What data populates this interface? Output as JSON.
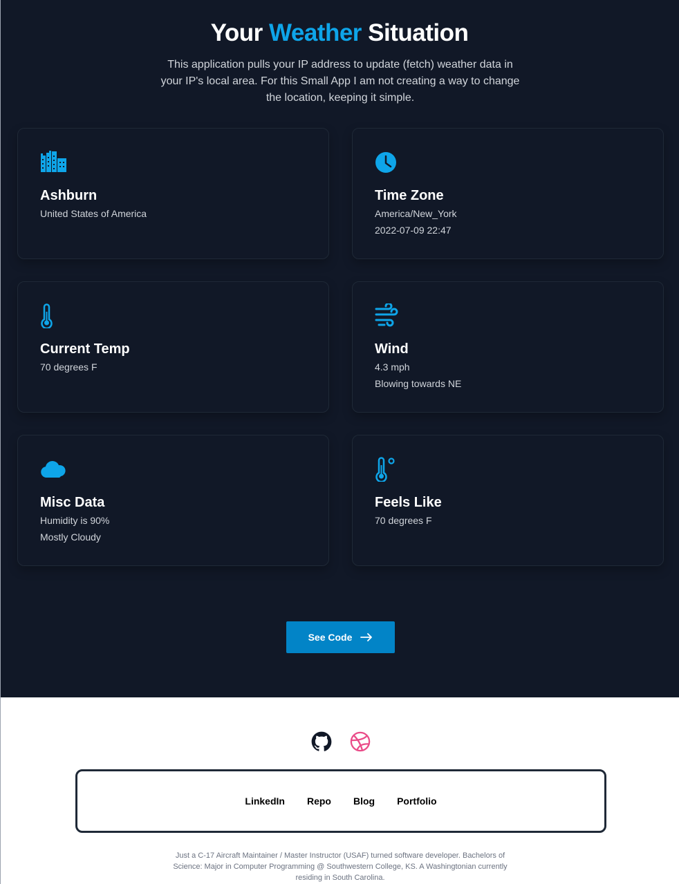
{
  "hero": {
    "title_part1": "Your",
    "title_accent": "Weather",
    "title_part2": "Situation",
    "subtitle": "This application pulls your IP address to update (fetch) weather data in your IP's local area. For this Small App I am not creating a way to change the location, keeping it simple."
  },
  "cards": [
    {
      "icon": "city-icon",
      "title": "Ashburn",
      "line1": "United States of America",
      "line2": ""
    },
    {
      "icon": "clock-icon",
      "title": "Time Zone",
      "line1": "America/New_York",
      "line2": "2022-07-09 22:47"
    },
    {
      "icon": "thermometer-icon",
      "title": "Current Temp",
      "line1": "70 degrees F",
      "line2": ""
    },
    {
      "icon": "wind-icon",
      "title": "Wind",
      "line1": "4.3 mph",
      "line2": "Blowing towards NE"
    },
    {
      "icon": "cloud-icon",
      "title": "Misc Data",
      "line1": "Humidity is 90%",
      "line2": "Mostly Cloudy"
    },
    {
      "icon": "temperature-degree-icon",
      "title": "Feels Like",
      "line1": "70 degrees F",
      "line2": ""
    }
  ],
  "cta": {
    "label": "See Code"
  },
  "footer": {
    "social": [
      "github-icon",
      "dribbble-icon"
    ],
    "links": [
      "LinkedIn",
      "Repo",
      "Blog",
      "Portfolio"
    ],
    "bio": "Just a C-17 Aircraft Maintainer / Master Instructor (USAF) turned software developer. Bachelors of Science: Major in Computer Programming @ Southwestern College, KS. A Washingtonian currently residing in South Carolina."
  },
  "colors": {
    "background": "#111827",
    "accent": "#0ea5e9",
    "button": "#0284c7",
    "dribbble": "#ea4c89"
  }
}
